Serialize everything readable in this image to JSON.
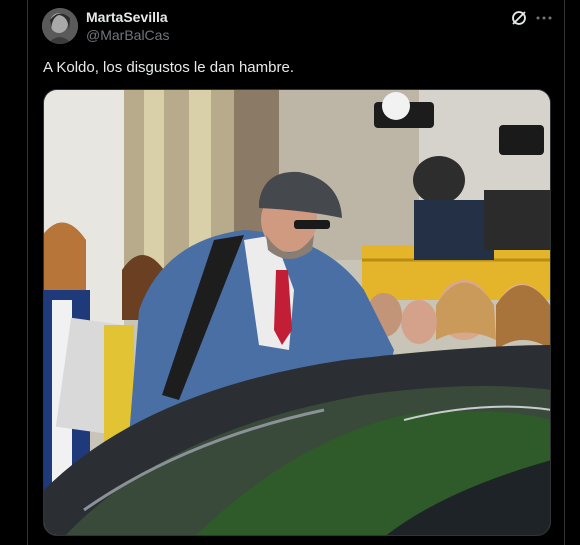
{
  "tweet": {
    "author": {
      "display_name": "MartaSevilla",
      "handle": "@MarBalCas",
      "avatar": "profile-photo"
    },
    "text": "A Koldo, los disgustos le dan hambre.",
    "media": {
      "type": "photo",
      "description_icon": "photo"
    }
  },
  "icons": {
    "grok": "grok-icon",
    "more": "more-options-icon"
  },
  "colors": {
    "background": "#000000",
    "text_primary": "#e7e9ea",
    "text_secondary": "#71767b",
    "border": "#2f3336"
  }
}
